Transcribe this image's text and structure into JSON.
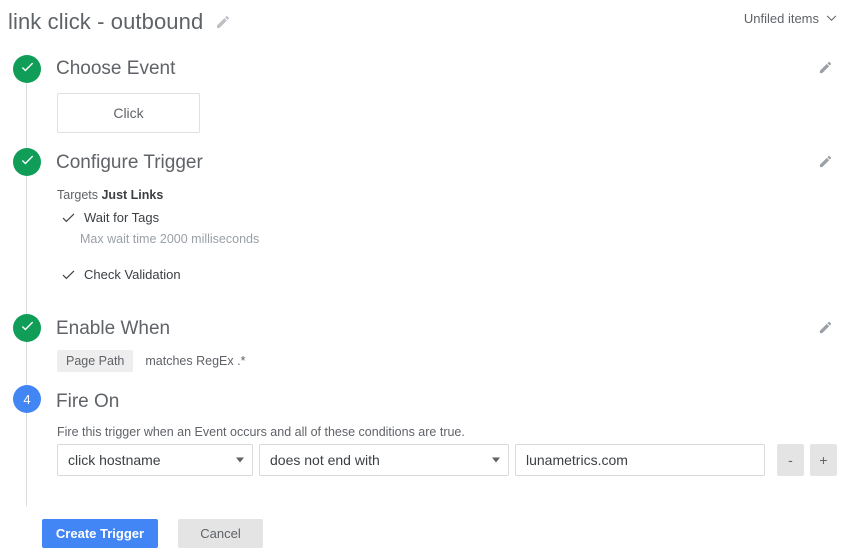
{
  "header": {
    "title": "link click - outbound",
    "edit_icon": "pencil-icon",
    "folder_label": "Unfiled items",
    "folder_caret_icon": "chevron-down-icon"
  },
  "steps": [
    {
      "index": "1",
      "state": "done",
      "marker_icon": "check-icon",
      "title": "Choose Event",
      "edit_icon": "pencil-icon",
      "event_button": "Click"
    },
    {
      "index": "2",
      "state": "done",
      "marker_icon": "check-icon",
      "title": "Configure Trigger",
      "edit_icon": "pencil-icon",
      "targets_label": "Targets",
      "targets_value": "Just Links",
      "options": [
        {
          "icon": "check-icon",
          "label": "Wait for Tags",
          "note": "Max wait time 2000 milliseconds"
        },
        {
          "icon": "check-icon",
          "label": "Check Validation",
          "note": ""
        }
      ]
    },
    {
      "index": "3",
      "state": "done",
      "marker_icon": "check-icon",
      "title": "Enable When",
      "edit_icon": "pencil-icon",
      "condition_chip": "Page Path",
      "condition_text": "matches RegEx .*"
    },
    {
      "index": "4",
      "state": "active",
      "marker_label": "4",
      "title": "Fire On",
      "description": "Fire this trigger when an Event occurs and all of these conditions are true.",
      "condition": {
        "variable": "click hostname",
        "operator": "does not end with",
        "value": "lunametrics.com",
        "value_placeholder": "",
        "remove_label": "-",
        "add_label": "+"
      }
    }
  ],
  "footer": {
    "submit_label": "Create Trigger",
    "cancel_label": "Cancel"
  },
  "colors": {
    "done_green": "#0f9d58",
    "active_blue": "#4285f4",
    "rail_grey": "#dadce0",
    "chip_grey": "#eeeeee",
    "text_grey": "#5f6368"
  }
}
